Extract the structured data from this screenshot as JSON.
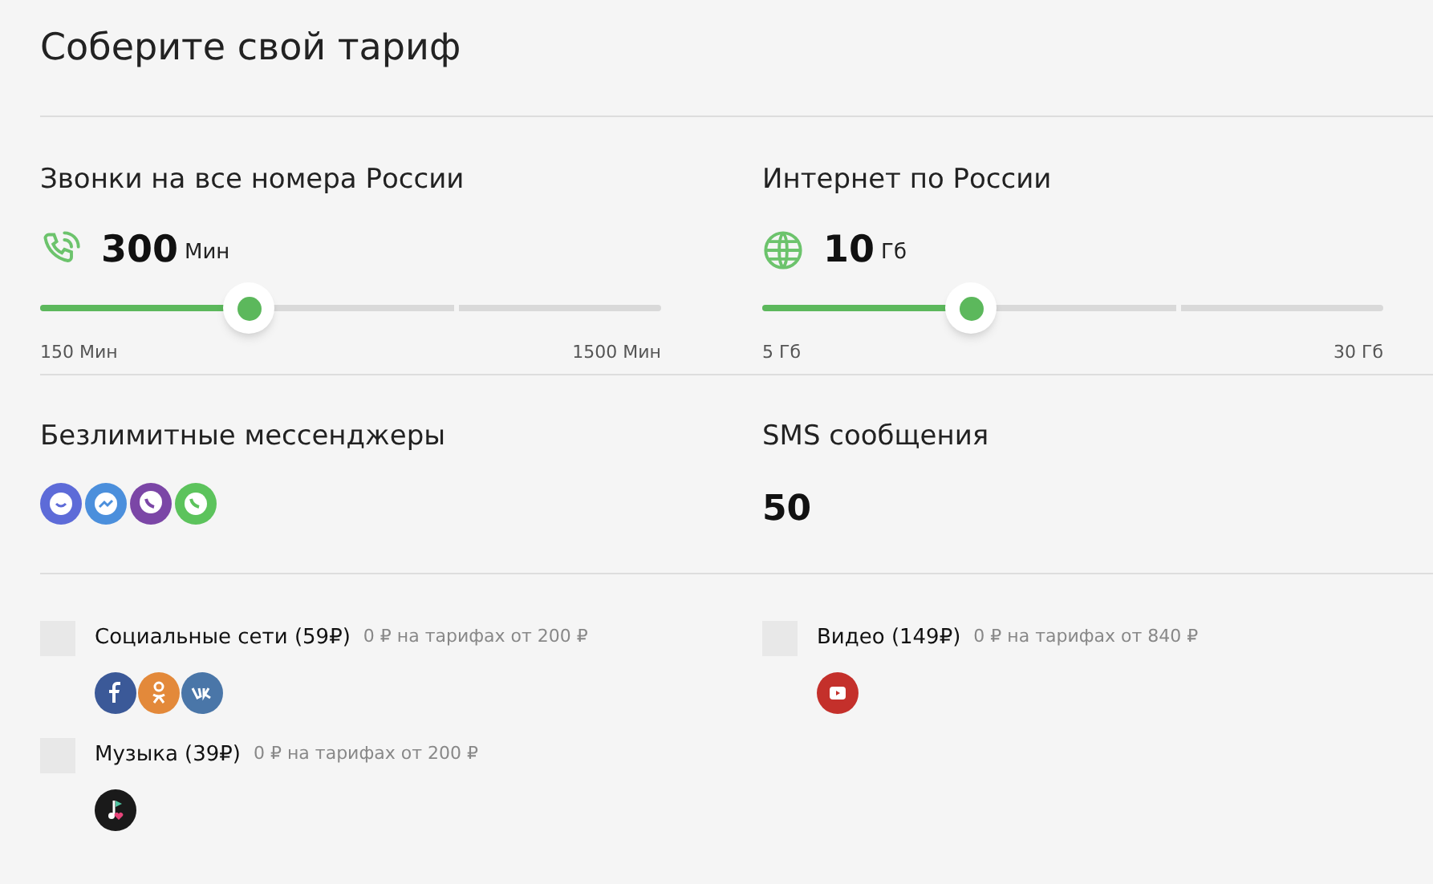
{
  "title": "Соберите свой тариф",
  "sliders": [
    {
      "label": "Звонки на все номера России",
      "kind": "phone",
      "value": "300",
      "unit": "Мин",
      "level": 0.336,
      "min": "150 Мин",
      "max": "1500 Мин"
    },
    {
      "label": "Интернет по России",
      "kind": "globe",
      "value": "10",
      "unit": "Гб",
      "level": 0.336,
      "min": "5 Гб",
      "max": "30 Гб"
    }
  ],
  "messengers": {
    "label": "Безлимитные мессенджеры"
  },
  "sms": {
    "label": "SMS сообщения",
    "value": "50"
  },
  "addons": [
    {
      "name": "Социальные сети (59₽)",
      "note": "0 ₽ на тарифах от 200 ₽",
      "checked": false
    },
    {
      "name": "Видео (149₽)",
      "note": "0 ₽ на тарифах от 840 ₽",
      "checked": false
    },
    {
      "name": "Музыка (39₽)",
      "note": "0 ₽ на тарифах от 200 ₽",
      "checked": false
    }
  ]
}
